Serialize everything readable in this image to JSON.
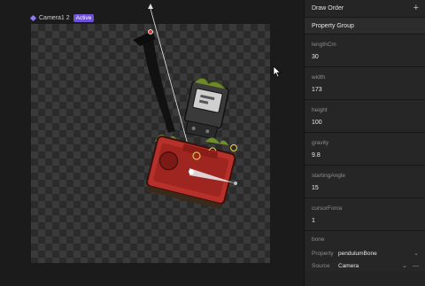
{
  "canvas": {
    "artboard_name": "Camera1 2",
    "artboard_badge": "Active"
  },
  "sidebar": {
    "draw_order_label": "Draw Order",
    "add_icon": "plus-icon",
    "group_label": "Property Group",
    "properties": [
      {
        "label": "lengthCm",
        "value": "30"
      },
      {
        "label": "width",
        "value": "173"
      },
      {
        "label": "height",
        "value": "100"
      },
      {
        "label": "gravity",
        "value": "9.8"
      },
      {
        "label": "startingAngle",
        "value": "15"
      },
      {
        "label": "cursorForce",
        "value": "1"
      }
    ],
    "bone": {
      "title": "bone",
      "property_key": "Property",
      "property_value": "pendulumBone",
      "source_key": "Source",
      "source_value": "Camera",
      "remove_symbol": "—"
    }
  },
  "colors": {
    "accent": "#8e7cf0",
    "badge": "#6e4fd8",
    "camera_body": "#b8302a"
  }
}
